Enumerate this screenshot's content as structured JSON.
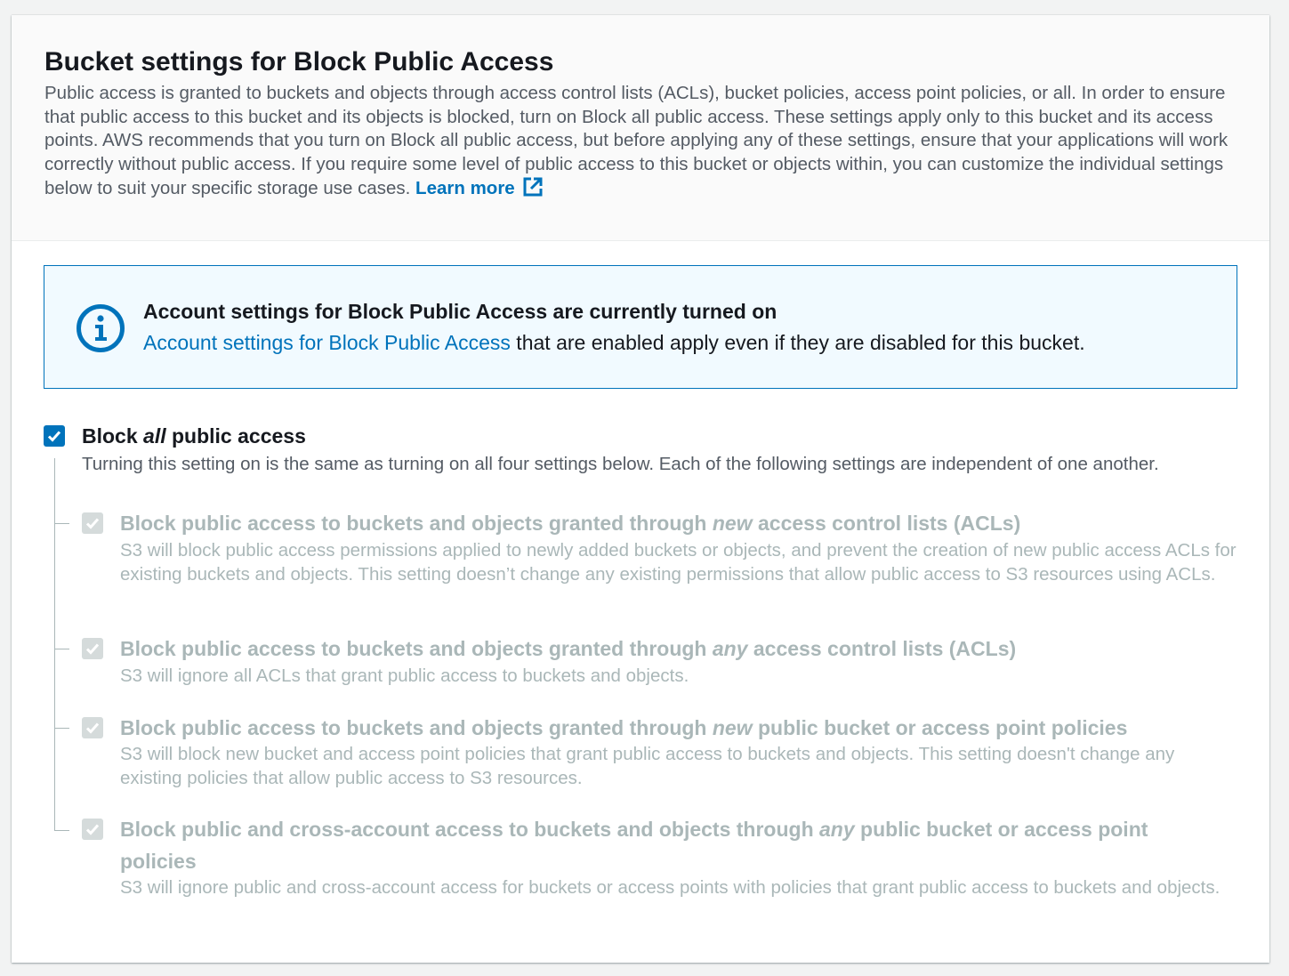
{
  "panel": {
    "title": "Bucket settings for Block Public Access",
    "description": "Public access is granted to buckets and objects through access control lists (ACLs), bucket policies, access point policies, or all. In order to ensure that public access to this bucket and its objects is blocked, turn on Block all public access. These settings apply only to this bucket and its access points. AWS recommends that you turn on Block all public access, but before applying any of these settings, ensure that your applications will work correctly without public access. If you require some level of public access to this bucket or objects within, you can customize the individual settings below to suit your specific storage use cases.",
    "learn_more": "Learn more",
    "learn_more_icon": "external-link-icon"
  },
  "alert": {
    "icon": "info-icon",
    "title": "Account settings for Block Public Access are currently turned on",
    "link_text": "Account settings for Block Public Access",
    "body_suffix": " that are enabled apply even if they are disabled for this bucket."
  },
  "block_all": {
    "label_prefix": "Block ",
    "label_emphasis": "all",
    "label_suffix": " public access",
    "description": "Turning this setting on is the same as turning on all four settings below. Each of the following settings are independent of one another.",
    "checked": true
  },
  "settings": [
    {
      "label_prefix": "Block public access to buckets and objects granted through ",
      "label_emphasis": "new",
      "label_suffix": " access control lists (ACLs)",
      "description": "S3 will block public access permissions applied to newly added buckets or objects, and prevent the creation of new public access ACLs for existing buckets and objects. This setting doesn’t change any existing permissions that allow public access to S3 resources using ACLs.",
      "checked": true,
      "disabled": true
    },
    {
      "label_prefix": "Block public access to buckets and objects granted through ",
      "label_emphasis": "any",
      "label_suffix": " access control lists (ACLs)",
      "description": "S3 will ignore all ACLs that grant public access to buckets and objects.",
      "checked": true,
      "disabled": true
    },
    {
      "label_prefix": "Block public access to buckets and objects granted through ",
      "label_emphasis": "new",
      "label_suffix": " public bucket or access point policies",
      "description": "S3 will block new bucket and access point policies that grant public access to buckets and objects. This setting doesn't change any existing policies that allow public access to S3 resources.",
      "checked": true,
      "disabled": true
    },
    {
      "label_prefix": "Block public and cross-account access to buckets and objects through ",
      "label_emphasis": "any",
      "label_suffix": " public bucket or access point policies",
      "description": "S3 will ignore public and cross-account access for buckets or access points with policies that grant public access to buckets and objects.",
      "checked": true,
      "disabled": true
    }
  ],
  "colors": {
    "link": "#0073bb",
    "checkbox_on": "#0073bb",
    "checkbox_disabled": "#d5dbdb",
    "disabled_text": "#aab7b8",
    "alert_bg": "#f1faff"
  }
}
